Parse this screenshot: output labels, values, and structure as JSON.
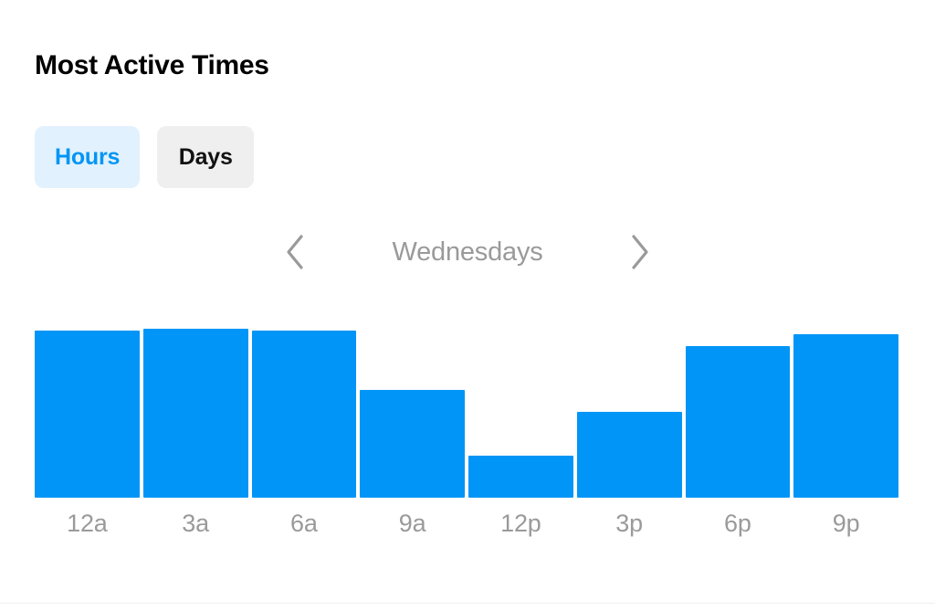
{
  "card": {
    "title": "Most Active Times"
  },
  "toggle": {
    "options": [
      {
        "label": "Hours",
        "active": true
      },
      {
        "label": "Days",
        "active": false
      }
    ]
  },
  "period_nav": {
    "prev_icon": "chevron-left-icon",
    "next_icon": "chevron-right-icon",
    "label": "Wednesdays"
  },
  "colors": {
    "bar": "#0095F6",
    "accent": "#0095F6",
    "active_chip_bg": "#E1F1FD",
    "inactive_chip_bg": "#EFEFEF",
    "axis_label": "#9A9A9A",
    "title": "#000000",
    "divider": "#EFEFEF",
    "background": "#FFFFFF"
  },
  "chart_data": {
    "type": "bar",
    "title": "Most Active Times",
    "subtitle": "Wednesdays",
    "xlabel": "",
    "ylabel": "",
    "grid": false,
    "legend": false,
    "ylim": [
      0,
      100
    ],
    "categories": [
      "12a",
      "3a",
      "6a",
      "9a",
      "12p",
      "3p",
      "6p",
      "9p"
    ],
    "values": [
      99,
      100,
      99,
      64,
      25,
      51,
      90,
      97
    ],
    "bar_color": "#0095F6"
  }
}
